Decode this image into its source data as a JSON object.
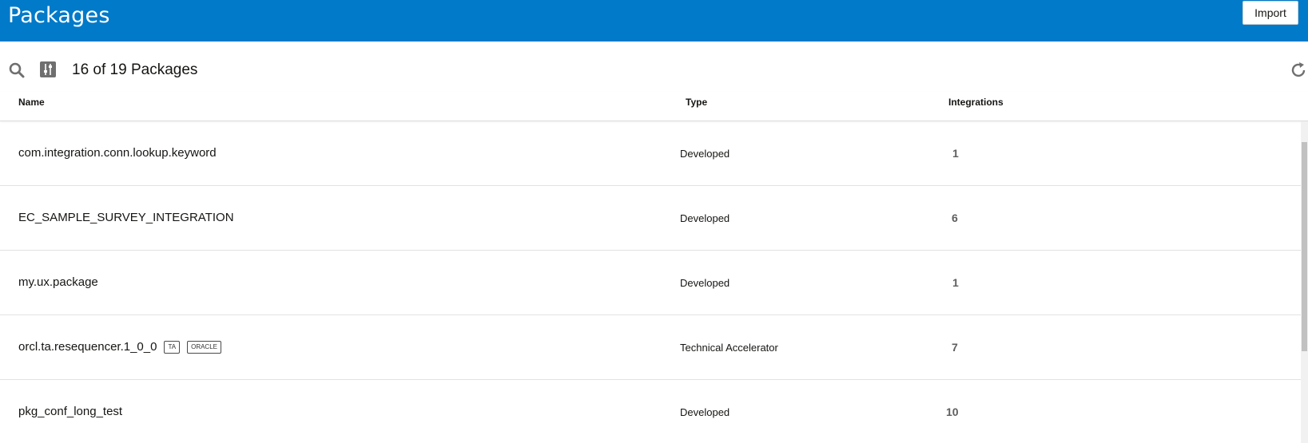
{
  "header": {
    "title": "Packages",
    "import_label": "Import"
  },
  "toolbar": {
    "count_text": "16 of 19 Packages"
  },
  "columns": {
    "name": "Name",
    "type": "Type",
    "integrations": "Integrations"
  },
  "rows": [
    {
      "name": "com.integration.conn.lookup.keyword",
      "type": "Developed",
      "integrations": "1",
      "badges": []
    },
    {
      "name": "EC_SAMPLE_SURVEY_INTEGRATION",
      "type": "Developed",
      "integrations": "6",
      "badges": []
    },
    {
      "name": "my.ux.package",
      "type": "Developed",
      "integrations": "1",
      "badges": []
    },
    {
      "name": "orcl.ta.resequencer.1_0_0",
      "type": "Technical Accelerator",
      "integrations": "7",
      "badges": [
        "TA",
        "ORACLE"
      ]
    },
    {
      "name": "pkg_conf_long_test",
      "type": "Developed",
      "integrations": "10",
      "badges": []
    }
  ],
  "icons": {
    "search": "search-icon",
    "filter": "filter-icon",
    "refresh": "refresh-icon"
  },
  "colors": {
    "header_bg": "#007ac9"
  }
}
